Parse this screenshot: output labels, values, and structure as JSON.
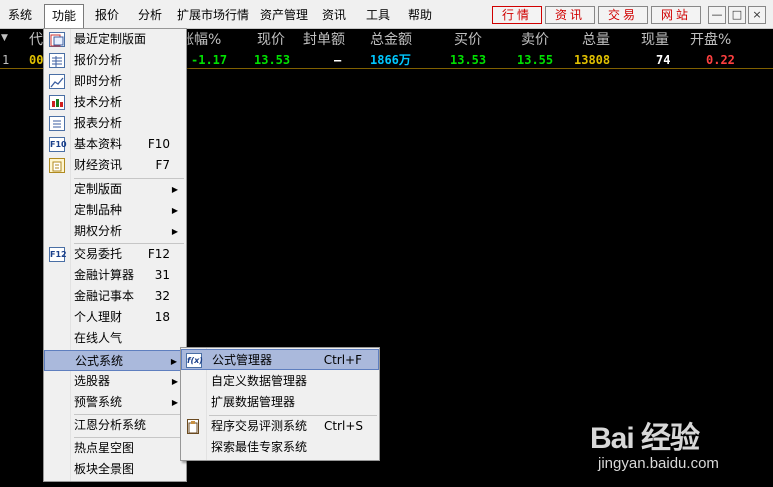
{
  "menubar": {
    "items": [
      "系统",
      "功能",
      "报价",
      "分析",
      "扩展市场行情",
      "资产管理",
      "资讯",
      "工具",
      "帮助"
    ],
    "active_index": 1,
    "quick_buttons": [
      "行情",
      "资讯",
      "交易",
      "网站"
    ],
    "window_controls": {
      "minimize": "—",
      "restore": "□",
      "close": "×"
    }
  },
  "quote_header": {
    "code_label": "代",
    "columns": [
      "涨幅%",
      "现价",
      "封单额",
      "总金额",
      "买价",
      "卖价",
      "总量",
      "现量",
      "开盘%"
    ]
  },
  "quote_row": {
    "index": "1",
    "code": "00",
    "change_pct": "-1.17",
    "price": "13.53",
    "seal_amount": "—",
    "total_amount": "1866万",
    "bid": "13.53",
    "ask": "13.55",
    "volume": "13808",
    "current_vol": "74",
    "open_pct": "0.22"
  },
  "function_menu": {
    "items": [
      {
        "label": "最近定制版面",
        "icon": "recent-layout-icon"
      },
      {
        "label": "报价分析",
        "icon": "quote-grid-icon"
      },
      {
        "label": "即时分析",
        "icon": "line-chart-icon"
      },
      {
        "label": "技术分析",
        "icon": "candlestick-icon"
      },
      {
        "label": "报表分析",
        "icon": "report-icon"
      },
      {
        "label": "基本资料",
        "icon": "f10-icon",
        "shortcut": "F10"
      },
      {
        "label": "财经资讯",
        "icon": "news-icon",
        "shortcut": "F7"
      },
      {
        "label": "定制版面",
        "submenu": true
      },
      {
        "label": "定制品种",
        "submenu": true
      },
      {
        "label": "期权分析",
        "submenu": true
      },
      {
        "label": "交易委托",
        "icon": "f12-icon",
        "shortcut": "F12"
      },
      {
        "label": "金融计算器",
        "shortcut": "31"
      },
      {
        "label": "金融记事本",
        "shortcut": "32"
      },
      {
        "label": "个人理财",
        "shortcut": "18"
      },
      {
        "label": "在线人气"
      },
      {
        "label": "公式系统",
        "submenu": true,
        "highlighted": true
      },
      {
        "label": "选股器",
        "submenu": true
      },
      {
        "label": "预警系统",
        "submenu": true
      },
      {
        "label": "江恩分析系统"
      },
      {
        "label": "热点星空图"
      },
      {
        "label": "板块全景图"
      }
    ]
  },
  "formula_submenu": {
    "items": [
      {
        "label": "公式管理器",
        "shortcut": "Ctrl+F",
        "icon": "formula-icon",
        "highlighted": true
      },
      {
        "label": "自定义数据管理器"
      },
      {
        "label": "扩展数据管理器"
      },
      {
        "label": "程序交易评测系统",
        "shortcut": "Ctrl+S",
        "icon": "clipboard-icon"
      },
      {
        "label": "探索最佳专家系统"
      }
    ]
  },
  "watermark": {
    "brand": "Bai 经验",
    "url": "jingyan.baidu.com"
  },
  "colors": {
    "up": "#ff4040",
    "down": "#00e000",
    "neutral": "#ffffff",
    "amount": "#00c8ff",
    "volume": "#e0c000",
    "menu_highlight": "#aab9dc",
    "quick_button_text": "#d00000"
  }
}
